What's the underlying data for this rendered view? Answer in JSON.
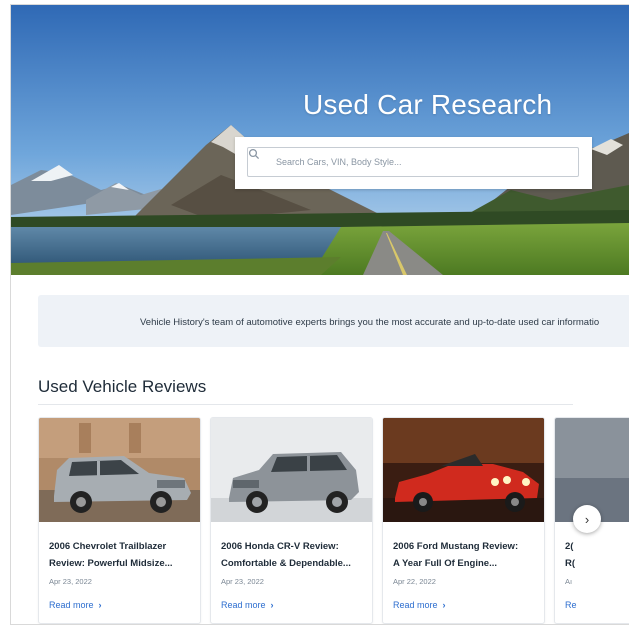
{
  "hero": {
    "title": "Used Car Research",
    "search_placeholder": "Search Cars, VIN, Body Style...",
    "search_value": ""
  },
  "banner": {
    "text": "Vehicle History's team of automotive experts brings you the most accurate and up-to-date used car informatio"
  },
  "reviews": {
    "heading": "Used Vehicle Reviews",
    "cards": [
      {
        "title_line1": "2006 Chevrolet Trailblazer",
        "title_line2": "Review: Powerful Midsize...",
        "date": "Apr 23, 2022",
        "link": "Read more",
        "car_color": "#a7adb2"
      },
      {
        "title_line1": "2006 Honda CR-V Review:",
        "title_line2": "Comfortable & Dependable...",
        "date": "Apr 23, 2022",
        "link": "Read more",
        "car_color": "#8d9399"
      },
      {
        "title_line1": "2006 Ford Mustang Review:",
        "title_line2": "A Year Full Of Engine...",
        "date": "Apr 22, 2022",
        "link": "Read more",
        "car_color": "#d02a1e"
      },
      {
        "title_line1": "2(",
        "title_line2": "R(",
        "date": "Aı",
        "link": "Re",
        "car_color": "#6b7480"
      }
    ],
    "next_icon": "chevron-right-icon"
  },
  "colors": {
    "link": "#2d6ecf",
    "banner_bg": "#eef2f7",
    "text_dark": "#1e2b38"
  }
}
